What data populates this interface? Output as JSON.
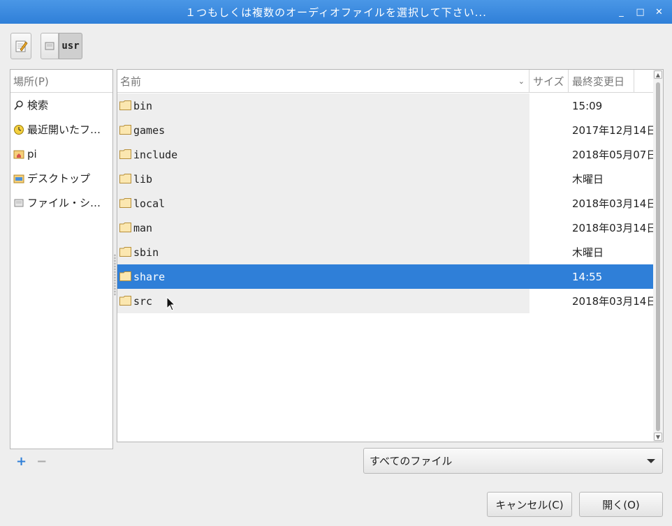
{
  "window": {
    "title": "１つもしくは複数のオーディオファイルを選択して下さい...",
    "controls": [
      "_",
      "□",
      "✕"
    ]
  },
  "pathbar": {
    "current": "usr"
  },
  "places": {
    "header": "場所(P)",
    "items": [
      {
        "label": "検索",
        "icon": "search-icon"
      },
      {
        "label": "最近開いたフ…",
        "icon": "recent-icon"
      },
      {
        "label": "pi",
        "icon": "home-folder-icon"
      },
      {
        "label": "デスクトップ",
        "icon": "desktop-icon"
      },
      {
        "label": "ファイル・シ…",
        "icon": "drive-icon"
      }
    ]
  },
  "filelist": {
    "columns": {
      "name": "名前",
      "size": "サイズ",
      "modified": "最終変更日"
    },
    "rows": [
      {
        "name": "bin",
        "modified": "15:09"
      },
      {
        "name": "games",
        "modified": "2017年12月14日"
      },
      {
        "name": "include",
        "modified": "2018年05月07日"
      },
      {
        "name": "lib",
        "modified": "木曜日"
      },
      {
        "name": "local",
        "modified": "2018年03月14日"
      },
      {
        "name": "man",
        "modified": "2018年03月14日"
      },
      {
        "name": "sbin",
        "modified": "木曜日"
      },
      {
        "name": "share",
        "modified": "14:55",
        "selected": true
      },
      {
        "name": "src",
        "modified": "2018年03月14日"
      }
    ]
  },
  "bookmarks": {
    "add": "+",
    "remove": "−"
  },
  "filter": {
    "selected": "すべてのファイル"
  },
  "buttons": {
    "cancel": "キャンセル(C)",
    "open": "開く(O)"
  },
  "colors": {
    "accent": "#2f7fd8",
    "titlebar": "#3a88de"
  }
}
